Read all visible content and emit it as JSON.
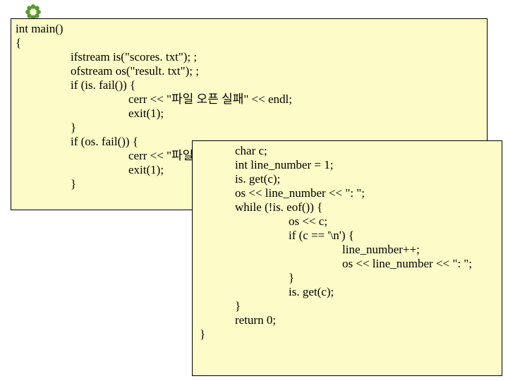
{
  "block1": {
    "l0": "int main()",
    "l1": "{",
    "l2": "ifstream is(\"scores. txt\"); ;",
    "l3": "ofstream os(\"result. txt\"); ;",
    "l4": "if (is. fail()) {",
    "l5": "cerr << \"파일 오픈 실패\" << endl;",
    "l6": "exit(1);",
    "l7": "}",
    "l8": "if (os. fail()) {",
    "l9": "cerr << \"파일",
    "l10": "exit(1);",
    "l11": "}"
  },
  "block2": {
    "l0": "char c;",
    "l1": "",
    "l2": "int line_number = 1;",
    "l3": "is. get(c);",
    "l4": "os << line_number << \": \";",
    "l5": "while (!is. eof()) {",
    "l6": "os << c;",
    "l7": "if (c == '\\n') {",
    "l8": "line_number++;",
    "l9": "os << line_number << \": \";",
    "l10": "}",
    "l11": "is. get(c);",
    "l12": "}",
    "l13": "return 0;",
    "l14": "}"
  }
}
